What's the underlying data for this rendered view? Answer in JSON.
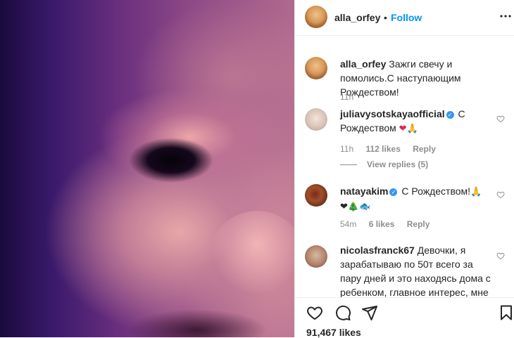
{
  "post": {
    "author": "alla_orfey",
    "follow_label": "Follow",
    "separator": "•",
    "more_label": "•••",
    "caption": "Зажги свечу и помолись.С наступающим Рождеством!",
    "caption_time": "11h",
    "likes": "91,467 likes"
  },
  "comments": [
    {
      "user": "juliavysotskaya­official",
      "text": "С Рождеством",
      "emojis": "❤🙏",
      "time": "11h",
      "likes": "112 likes",
      "reply": "Reply",
      "view_replies": "View replies (5)"
    },
    {
      "user": "natayakim",
      "text": "С Рождеством!",
      "emojis": "🙏",
      "emojis2": "❤🎄🐟",
      "time": "54m",
      "likes": "6 likes",
      "reply": "Reply"
    },
    {
      "user": "nicolasfranck67",
      "text": "Девочки, я зарабатываю по 50т всего за пару дней и это находясь дома с ребенком, главное интерес, мне"
    }
  ],
  "icons": {
    "like": "heart-icon",
    "comment": "comment-icon",
    "share": "share-icon",
    "save": "bookmark-icon",
    "more": "more-icon"
  },
  "colors": {
    "link": "#0095f6",
    "muted": "#8e8e8e",
    "verified": "#3897f0",
    "border": "#efefef"
  }
}
